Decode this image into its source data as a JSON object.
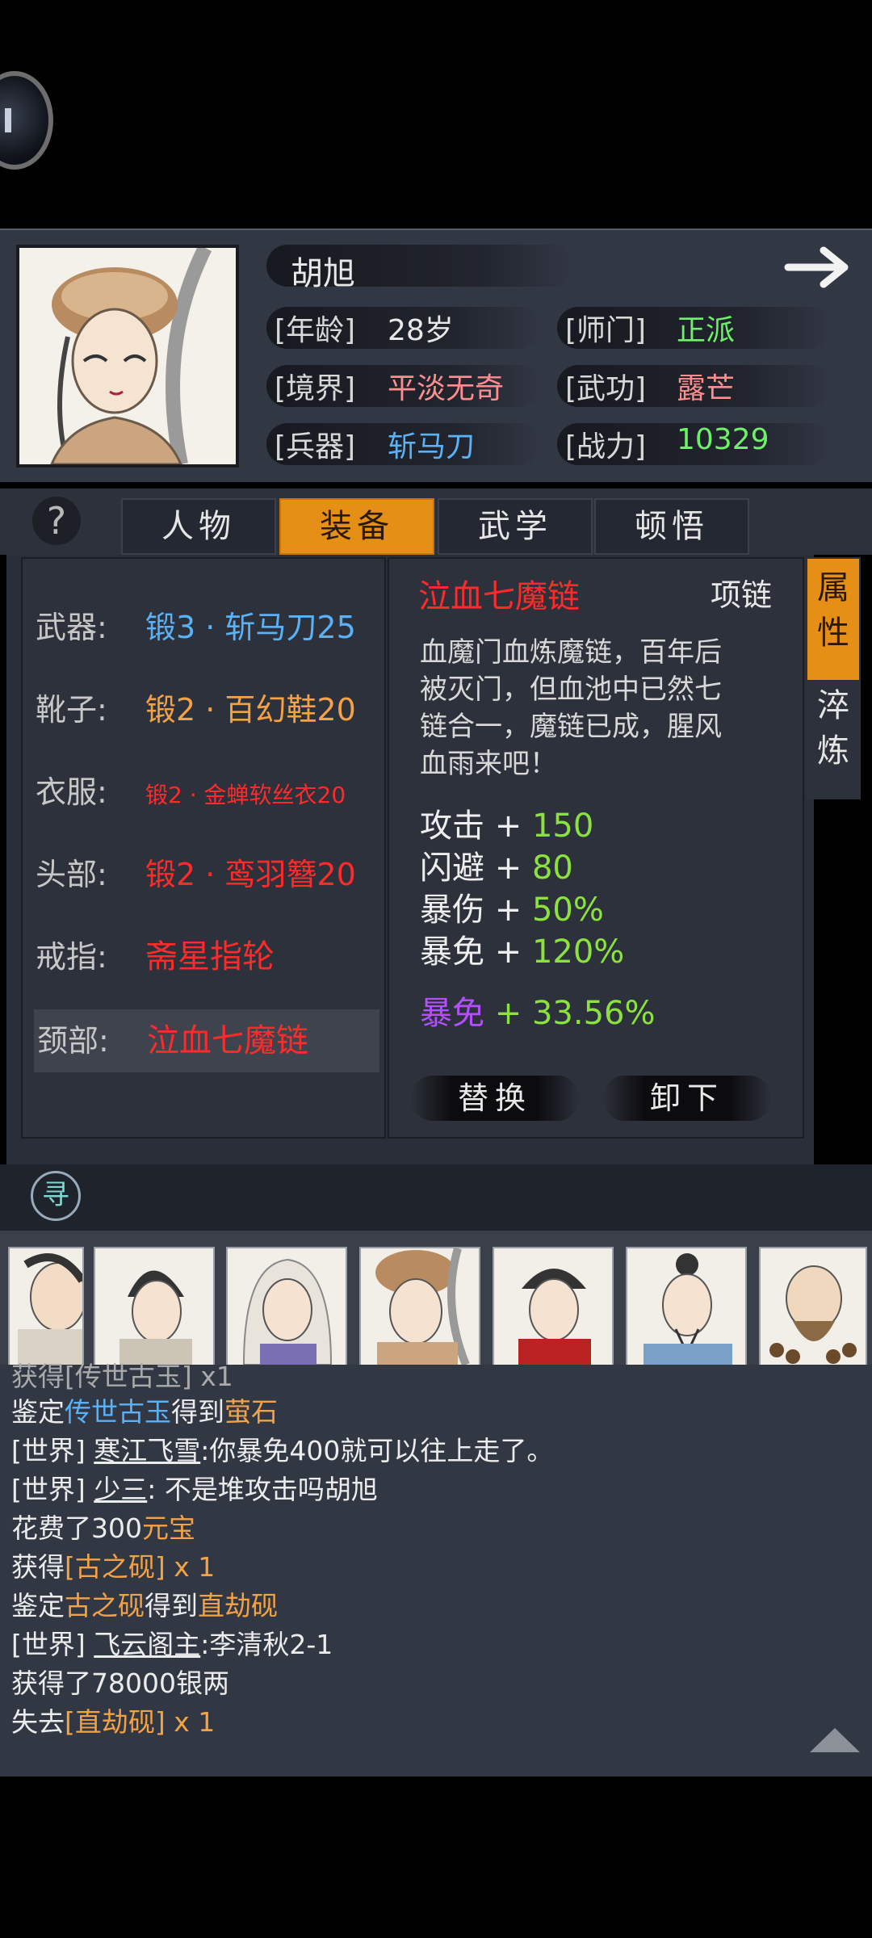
{
  "character": {
    "name": "胡旭",
    "age_label": "[年龄]",
    "age": "28岁",
    "sect_label": "[师门]",
    "sect": "正派",
    "realm_label": "[境界]",
    "realm": "平淡无奇",
    "skill_label": "[武功]",
    "skill": "露芒",
    "weapon_label": "[兵器]",
    "weapon": "斩马刀",
    "power_label": "[战力]",
    "power": "10329"
  },
  "tabs": [
    "人物",
    "装备",
    "武学",
    "顿悟"
  ],
  "active_tab": "装备",
  "help_icon": "?",
  "equipment": [
    {
      "slot": "武器:",
      "item": "锻3 · 斩马刀25",
      "color": "#5ab1f5"
    },
    {
      "slot": "靴子:",
      "item": "锻2 · 百幻鞋20",
      "color": "#f3a246"
    },
    {
      "slot": "衣服:",
      "item": "锻2 · 金蝉软丝衣20",
      "color": "#ff2a2a"
    },
    {
      "slot": "头部:",
      "item": "锻2 · 鸾羽簪20",
      "color": "#ff2a2a"
    },
    {
      "slot": "戒指:",
      "item": "斋星指轮",
      "color": "#ff2a2a"
    },
    {
      "slot": "颈部:",
      "item": "泣血七魔链",
      "color": "#ff2a2a"
    }
  ],
  "detail": {
    "name": "泣血七魔链",
    "type": "项链",
    "description": [
      "血魔门血炼魔链，百年后",
      "被灭门，但血池中已然七",
      "链合一，魔链已成，腥风",
      "血雨来吧！"
    ],
    "stats": [
      {
        "label": "攻击",
        "plus": "+",
        "value": "150"
      },
      {
        "label": "闪避",
        "plus": "+",
        "value": "80"
      },
      {
        "label": "暴伤",
        "plus": "+",
        "value": "50%"
      },
      {
        "label": "暴免",
        "plus": "+",
        "value": "120%"
      }
    ],
    "bonus": {
      "label": "暴免",
      "plus": "+",
      "value": "33.56%"
    },
    "replace_button": "替换",
    "unequip_button": "卸下"
  },
  "side_tabs": [
    "属性",
    "淬炼"
  ],
  "search_icon": "寻",
  "chat_log": {
    "line0": "获得[传世古玉] x1",
    "line1": [
      "鉴定",
      "传世古玉",
      "得到",
      "萤石"
    ],
    "line2": [
      "[世界]",
      "寒江飞雪",
      ":你暴免400就可以往上走了。"
    ],
    "line3": [
      "[世界]",
      "少三",
      ": 不是堆攻击吗胡旭"
    ],
    "line4": [
      "花费了300",
      "元宝"
    ],
    "line5": [
      "获得",
      "[古之砚]",
      " x 1"
    ],
    "line6": [
      "鉴定",
      "古之砚",
      "得到",
      "直劫砚"
    ],
    "line7": [
      "[世界]",
      "飞云阁主",
      ":李清秋2-1"
    ],
    "line8": "获得了78000银两",
    "line9": [
      "失去",
      "[直劫砚]",
      " x 1"
    ]
  },
  "icons": [
    "back-round-icon",
    "arrow-right-icon",
    "help-icon",
    "search-icon",
    "scroll-up-icon"
  ]
}
